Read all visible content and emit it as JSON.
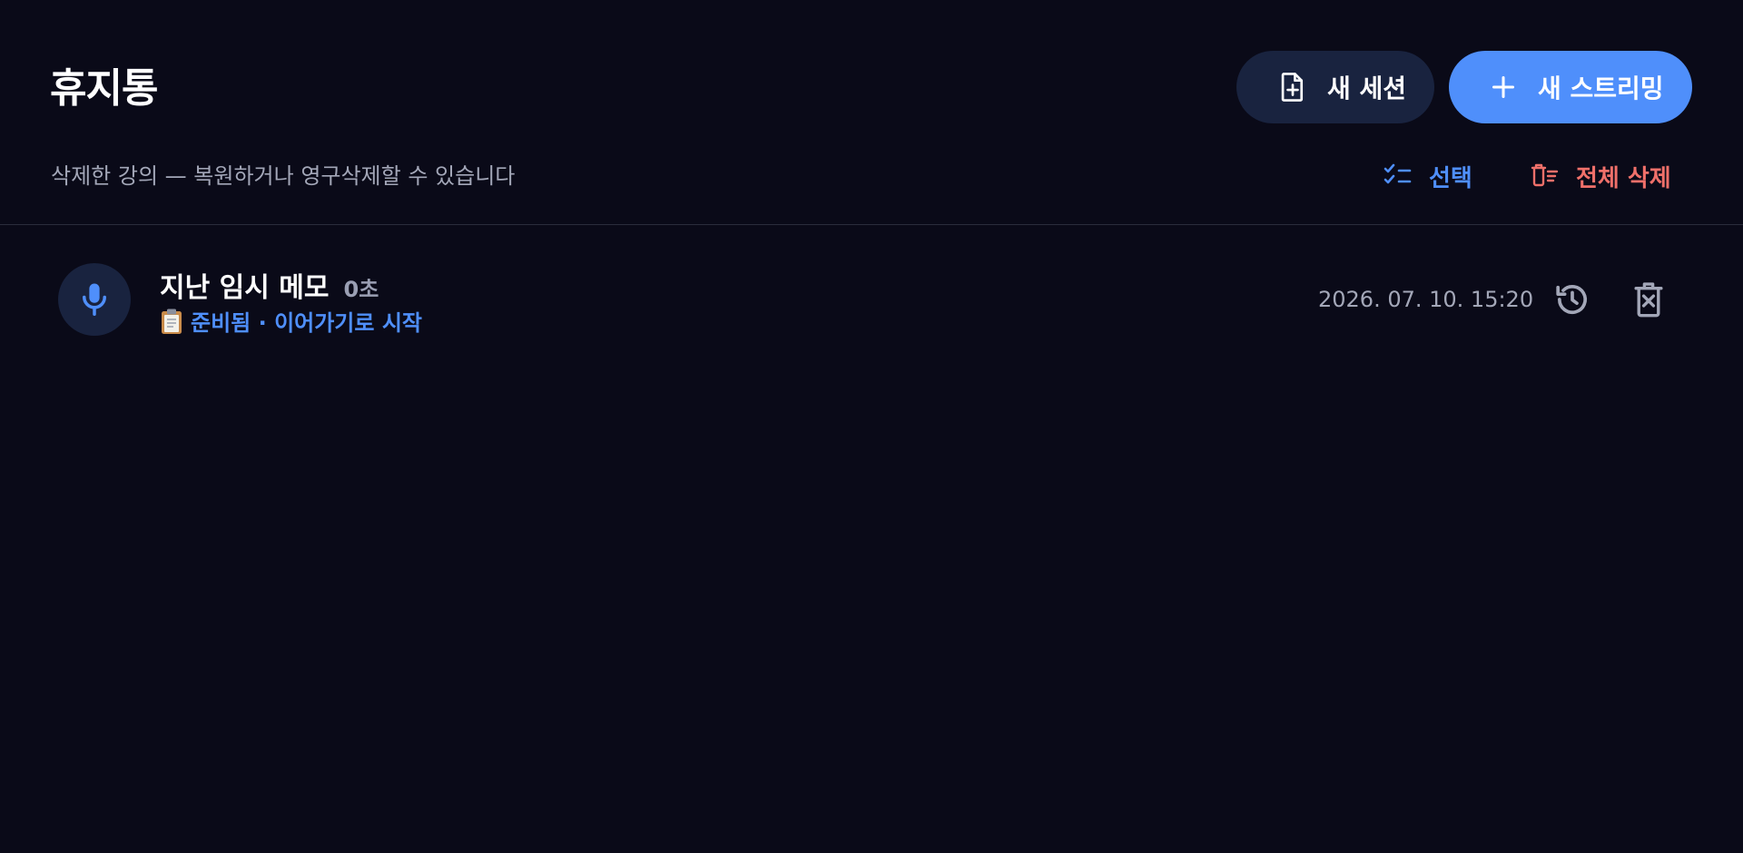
{
  "page": {
    "title": "휴지통",
    "subtitle": "삭제한 강의 — 복원하거나 영구삭제할 수 있습니다"
  },
  "toolbar": {
    "new_session_label": "새 세션",
    "new_session_icon": "file-plus-icon",
    "new_stream_label": "새 스트리밍",
    "new_stream_icon": "plus-icon",
    "select_label": "선택",
    "select_icon": "checklist-icon",
    "delete_all_label": "전체 삭제",
    "delete_all_icon": "trash-list-icon"
  },
  "items": [
    {
      "icon": "microphone-icon",
      "title": "지난 임시 메모",
      "duration": "0초",
      "status_icon": "clipboard-icon",
      "status": "준비됨 · 이어가기로 시작",
      "date": "2026. 07. 10. 15:20",
      "restore_icon": "restore-history-icon",
      "delete_icon": "delete-forever-icon"
    }
  ],
  "colors": {
    "background": "#0a0a18",
    "accent": "#4f8ffb",
    "danger": "#f0706a",
    "secondary_button": "#19233f",
    "muted_text": "#a3a7b8"
  }
}
